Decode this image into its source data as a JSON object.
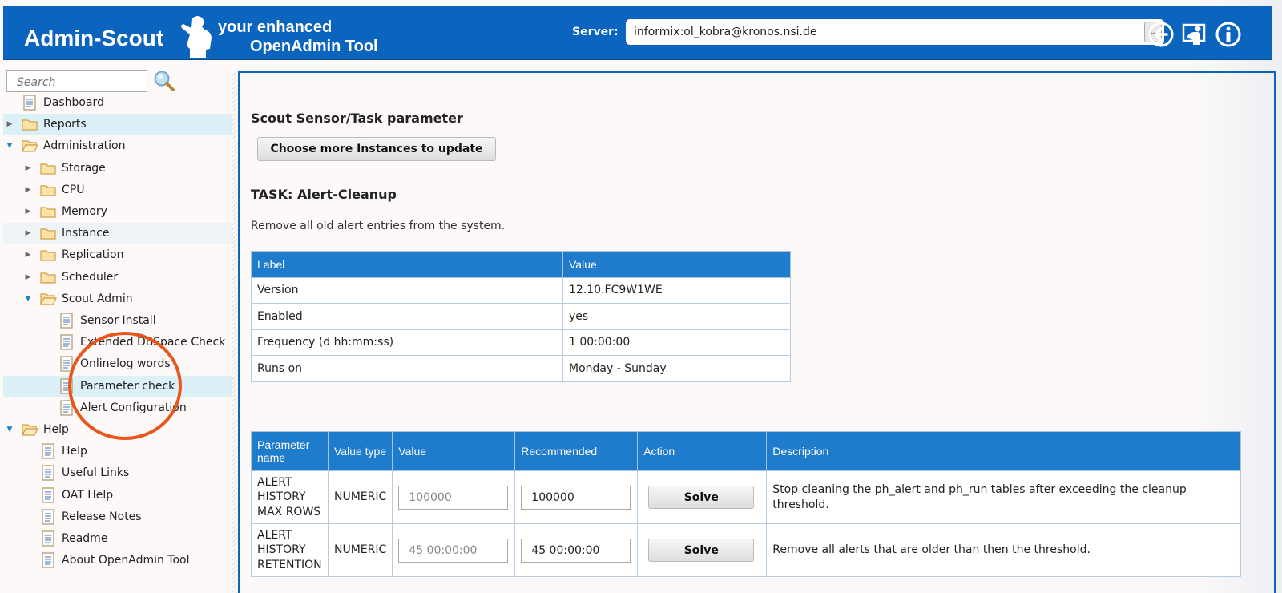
{
  "header": {
    "logo_title": "Admin-Scout",
    "logo_tagline_1": "your enhanced",
    "logo_tagline_2": "OpenAdmin Tool",
    "server_label": "Server:",
    "server_value": "informix:ol_kobra@kronos.nsi.de",
    "icons": [
      "back-arrow-icon",
      "presentation-icon",
      "info-icon"
    ]
  },
  "sidebar": {
    "search_placeholder": "Search",
    "items": [
      {
        "label": "Dashboard",
        "type": "page",
        "level": 0
      },
      {
        "label": "Reports",
        "type": "folder",
        "level": 0,
        "expanded": false
      },
      {
        "label": "Administration",
        "type": "folder",
        "level": 0,
        "expanded": true
      },
      {
        "label": "Storage",
        "type": "folder",
        "level": 1,
        "expanded": false
      },
      {
        "label": "CPU",
        "type": "folder",
        "level": 1,
        "expanded": false
      },
      {
        "label": "Memory",
        "type": "folder",
        "level": 1,
        "expanded": false
      },
      {
        "label": "Instance",
        "type": "folder",
        "level": 1,
        "expanded": false
      },
      {
        "label": "Replication",
        "type": "folder",
        "level": 1,
        "expanded": false
      },
      {
        "label": "Scheduler",
        "type": "folder",
        "level": 1,
        "expanded": false
      },
      {
        "label": "Scout Admin",
        "type": "folder",
        "level": 1,
        "expanded": true
      },
      {
        "label": "Sensor Install",
        "type": "page",
        "level": 2
      },
      {
        "label": "Extended DBSpace Check",
        "type": "page",
        "level": 2
      },
      {
        "label": "Onlinelog words",
        "type": "page",
        "level": 2
      },
      {
        "label": "Parameter check",
        "type": "page",
        "level": 2,
        "selected": true
      },
      {
        "label": "Alert Configuration",
        "type": "page",
        "level": 2
      },
      {
        "label": "Help",
        "type": "folder",
        "level": 0,
        "expanded": true
      },
      {
        "label": "Help",
        "type": "page",
        "level": 1
      },
      {
        "label": "Useful Links",
        "type": "page",
        "level": 1
      },
      {
        "label": "OAT Help",
        "type": "page",
        "level": 1
      },
      {
        "label": "Release Notes",
        "type": "page",
        "level": 1
      },
      {
        "label": "Readme",
        "type": "page",
        "level": 1
      },
      {
        "label": "About OpenAdmin Tool",
        "type": "page",
        "level": 1
      }
    ]
  },
  "main": {
    "section_title": "Scout Sensor/Task parameter",
    "choose_button": "Choose more Instances to update",
    "task_title": "TASK: Alert-Cleanup",
    "task_description": "Remove all old alert entries from the system.",
    "info_table": {
      "headers": [
        "Label",
        "Value"
      ],
      "rows": [
        [
          "Version",
          "12.10.FC9W1WE"
        ],
        [
          "Enabled",
          "yes"
        ],
        [
          "Frequency (d hh:mm:ss)",
          "1 00:00:00"
        ],
        [
          "Runs on",
          "Monday - Sunday"
        ]
      ]
    },
    "param_table": {
      "headers": [
        "Parameter name",
        "Value type",
        "Value",
        "Recommended",
        "Action",
        "Description"
      ],
      "rows": [
        {
          "name": "ALERT HISTORY MAX ROWS",
          "type": "NUMERIC",
          "value": "100000",
          "recommended": "100000",
          "action": "Solve",
          "description": "Stop cleaning the ph_alert and ph_run tables after exceeding the cleanup threshold."
        },
        {
          "name": "ALERT HISTORY RETENTION",
          "type": "NUMERIC",
          "value": "45 00:00:00",
          "recommended": "45 00:00:00",
          "action": "Solve",
          "description": "Remove all alerts that are older than then the threshold."
        }
      ]
    }
  },
  "colors": {
    "header_blue": "#0b64be",
    "table_header": "#1f7bcb",
    "highlight_circle": "#e8561c",
    "selected_row": "#dcf0f7"
  }
}
